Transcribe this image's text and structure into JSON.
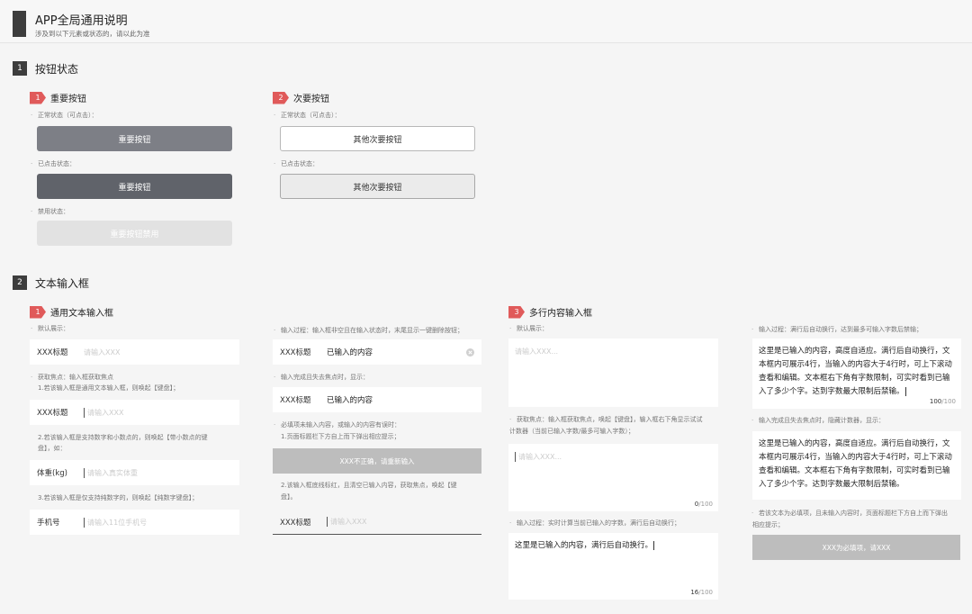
{
  "header": {
    "title": "APP全局通用说明",
    "subtitle": "涉及到以下元素或状态的，请以此为准"
  },
  "section1": {
    "num": "1",
    "title": "按钮状态",
    "primary": {
      "num": "1",
      "title": "重要按钮",
      "normal_note": "正常状态（可点击）：",
      "normal_label": "重要按钮",
      "pressed_note": "已点击状态：",
      "pressed_label": "重要按钮",
      "disabled_note": "禁用状态：",
      "disabled_label": "重要按钮禁用"
    },
    "secondary": {
      "num": "2",
      "title": "次要按钮",
      "normal_note": "正常状态（可点击）：",
      "normal_label": "其他次要按钮",
      "pressed_note": "已点击状态：",
      "pressed_label": "其他次要按钮"
    }
  },
  "section2": {
    "num": "2",
    "title": "文本输入框",
    "single": {
      "num": "1",
      "title": "通用文本输入框",
      "default_note": "默认展示：",
      "default_field": {
        "label": "XXX标题",
        "placeholder": "请输入XXX"
      },
      "focus_note": "获取焦点：输入框获取焦点",
      "focus_note_1": "1.若该输入框是通用文本输入框，则唤起【键盘】；",
      "focus_field_1": {
        "label": "XXX标题",
        "placeholder": "请输入XXX"
      },
      "focus_note_2a": "2.若该输入框是支持数字和小数点的，则唤起【带小数点的键",
      "focus_note_2b": "盘】，如：",
      "focus_field_2": {
        "label": "体重(kg)",
        "placeholder": "请输入真实体重"
      },
      "focus_note_3": "3.若该输入框是仅支持纯数字的，则唤起【纯数字键盘】；",
      "focus_field_3": {
        "label": "手机号",
        "placeholder": "请输入11位手机号"
      }
    },
    "single_b": {
      "typing_note": "输入过程：输入框非空且在输入状态时，末尾显示一键删除按钮；",
      "typing_field": {
        "label": "XXX标题",
        "value": "已输入的内容"
      },
      "done_note": "输入完成且失去焦点时，显示：",
      "done_field": {
        "label": "XXX标题",
        "value": "已输入的内容"
      },
      "required_note": "必填项未输入内容，或输入的内容有误时：",
      "required_note_1": "1.页面标题栏下方自上而下弹出相应提示；",
      "toast": "XXX不正确，请重新输入",
      "required_note_2a": "2.该输入框底线标红，且清空已输入内容，获取焦点，唤起【键",
      "required_note_2b": "盘】。",
      "error_field": {
        "label": "XXX标题",
        "placeholder": "请输入XXX"
      }
    },
    "multi": {
      "num": "3",
      "title": "多行内容输入框",
      "default_note": "默认展示：",
      "default_placeholder": "请输入XXX...",
      "focus_note_a": "获取焦点：输入框获取焦点，唤起【键盘】，输入框右下角显示试试",
      "focus_note_b": "计数器（当前已输入字数/最多可输入字数）；",
      "focus_placeholder": "请输入XXX...",
      "focus_count": "0",
      "focus_max": "/100",
      "typing_note": "输入过程：实时计算当前已输入的字数，满行后自动换行；",
      "typing_text": "这里是已输入的内容，满行后自动换行。",
      "typing_count": "16",
      "typing_max": "/100"
    },
    "multi_b": {
      "limit_note": "输入过程：满行后自动换行，达到最多可输入字数后禁输；",
      "limit_text": "这里是已输入的内容，高度自适应。满行后自动换行，文本框内可展示4行，当输入的内容大于4行时，可上下滚动查看和编辑。文本框右下角有字数限制，可实时看到已输入了多少个字。达到字数最大限制后禁输。",
      "limit_count": "100",
      "limit_max": "/100",
      "blur_note": "输入完成且失去焦点时，隐藏计数器，显示：",
      "blur_text": "这里是已输入的内容，高度自适应。满行后自动换行，文本框内可展示4行，当输入的内容大于4行时，可上下滚动查看和编辑。文本框右下角有字数限制，可实时看到已输入了多少个字。达到字数最大限制后禁输。",
      "required_note_a": "若该文本为必填项，且未输入内容时，页面标题栏下方自上而下弹出",
      "required_note_b": "相应提示；",
      "toast": "XXX为必填项，请XXX"
    }
  }
}
